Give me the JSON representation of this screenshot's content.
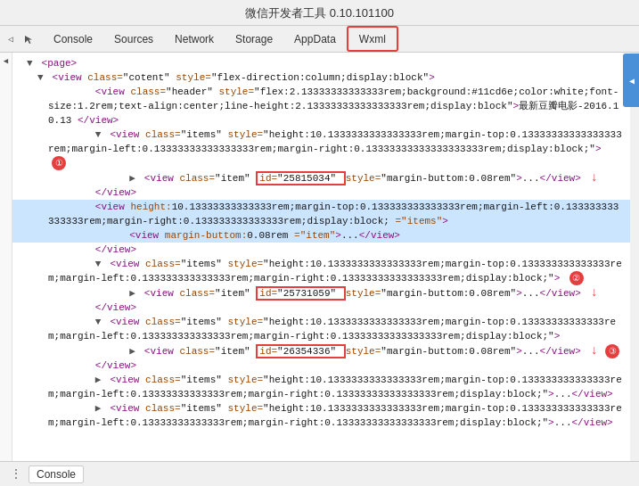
{
  "title": "微信开发者工具 0.10.101100",
  "tabs": [
    {
      "label": "Console",
      "active": false
    },
    {
      "label": "Sources",
      "active": false
    },
    {
      "label": "Network",
      "active": false
    },
    {
      "label": "Storage",
      "active": false
    },
    {
      "label": "AppData",
      "active": false
    },
    {
      "label": "Wxml",
      "active": true
    }
  ],
  "bottom_tabs": [
    {
      "label": "Console"
    }
  ],
  "code_lines": [
    {
      "indent": 1,
      "content": "▼ <page>"
    },
    {
      "indent": 2,
      "content": "▼ <view class=\"cotent\" style=\"flex-direction:column;display:block\">"
    },
    {
      "indent": 3,
      "content": "<view class=\"header\" style=\"flex:2.13333333333333rem;background:#11cd6e;color:white;font-size:1.2rem;text-align:center;line-height:2.13333333333333333rem;display:block\">最新豆瓣电影-2016.10.13 </view>"
    },
    {
      "indent": 3,
      "content": "▼ <view class=\"items\" style=\"height:10.1333333333333333rem;margin-top:0.133333333333333rem;margin-left:0.133333333333333rem;margin-right:0.133333333333333rem;display:block;\">"
    },
    {
      "indent": 4,
      "content": "▶ <view class=\"item\" id=\"25815034\" style=\"margin-buttom:0.08rem\">...</view>",
      "badge": 1,
      "has_arrow": true
    },
    {
      "indent": 3,
      "content": "</view>"
    },
    {
      "indent": 3,
      "content": "<view height:10.13333333333333rem;margin-top:0.133333333333333rem;margin-left:0.133333333333333rem;margin-right:0.133333333333333rem;display:block;=\"items\">"
    },
    {
      "indent": 4,
      "content": "<view margin-buttom:0.08rem=\"item\">...</view>"
    },
    {
      "indent": 3,
      "content": "</view>"
    },
    {
      "indent": 3,
      "content": "▼ <view class=\"items\" style=\"height:10.1333333333333333rem;margin-top:0.133333333333333rem;margin-left:0.133333333333333rem;margin-right:0.13333333333333333rem;display:block;\">"
    },
    {
      "indent": 4,
      "content": "▶ <view class=\"item\" id=\"25731059\" style=\"margin-buttom:0.08rem\">...</view>",
      "badge": 2,
      "has_arrow": true
    },
    {
      "indent": 3,
      "content": "</view>"
    },
    {
      "indent": 3,
      "content": "▼ <view class=\"items\" style=\"height:10.1333333333333333rem;margin-top:0.13333333333333rem;margin-left:0.133333333333333rem;margin-right:0.13333333333333333rem;display:block;\">"
    },
    {
      "indent": 4,
      "content": "▶ <view class=\"item\" id=\"26354336\" style=\"margin-buttom:0.08rem\">...</view>",
      "badge": 3,
      "has_arrow": true
    },
    {
      "indent": 3,
      "content": "</view>"
    },
    {
      "indent": 3,
      "content": "▶ <view class=\"items\" style=\"height:10.1333333333333333rem;margin-top:0.133333333333333rem;margin-left:0.13333333333333rem;margin-right:0.13333333333333333rem;display:block;\">...</view>"
    },
    {
      "indent": 3,
      "content": "▶ <view class=\"items\" style=\"height:10.1333333333333333rem;margin-top:0.133333333333333rem;margin-left:0.13333333333333rem;margin-right:0.13333333333333333rem;display:block;\">...</view>"
    }
  ]
}
